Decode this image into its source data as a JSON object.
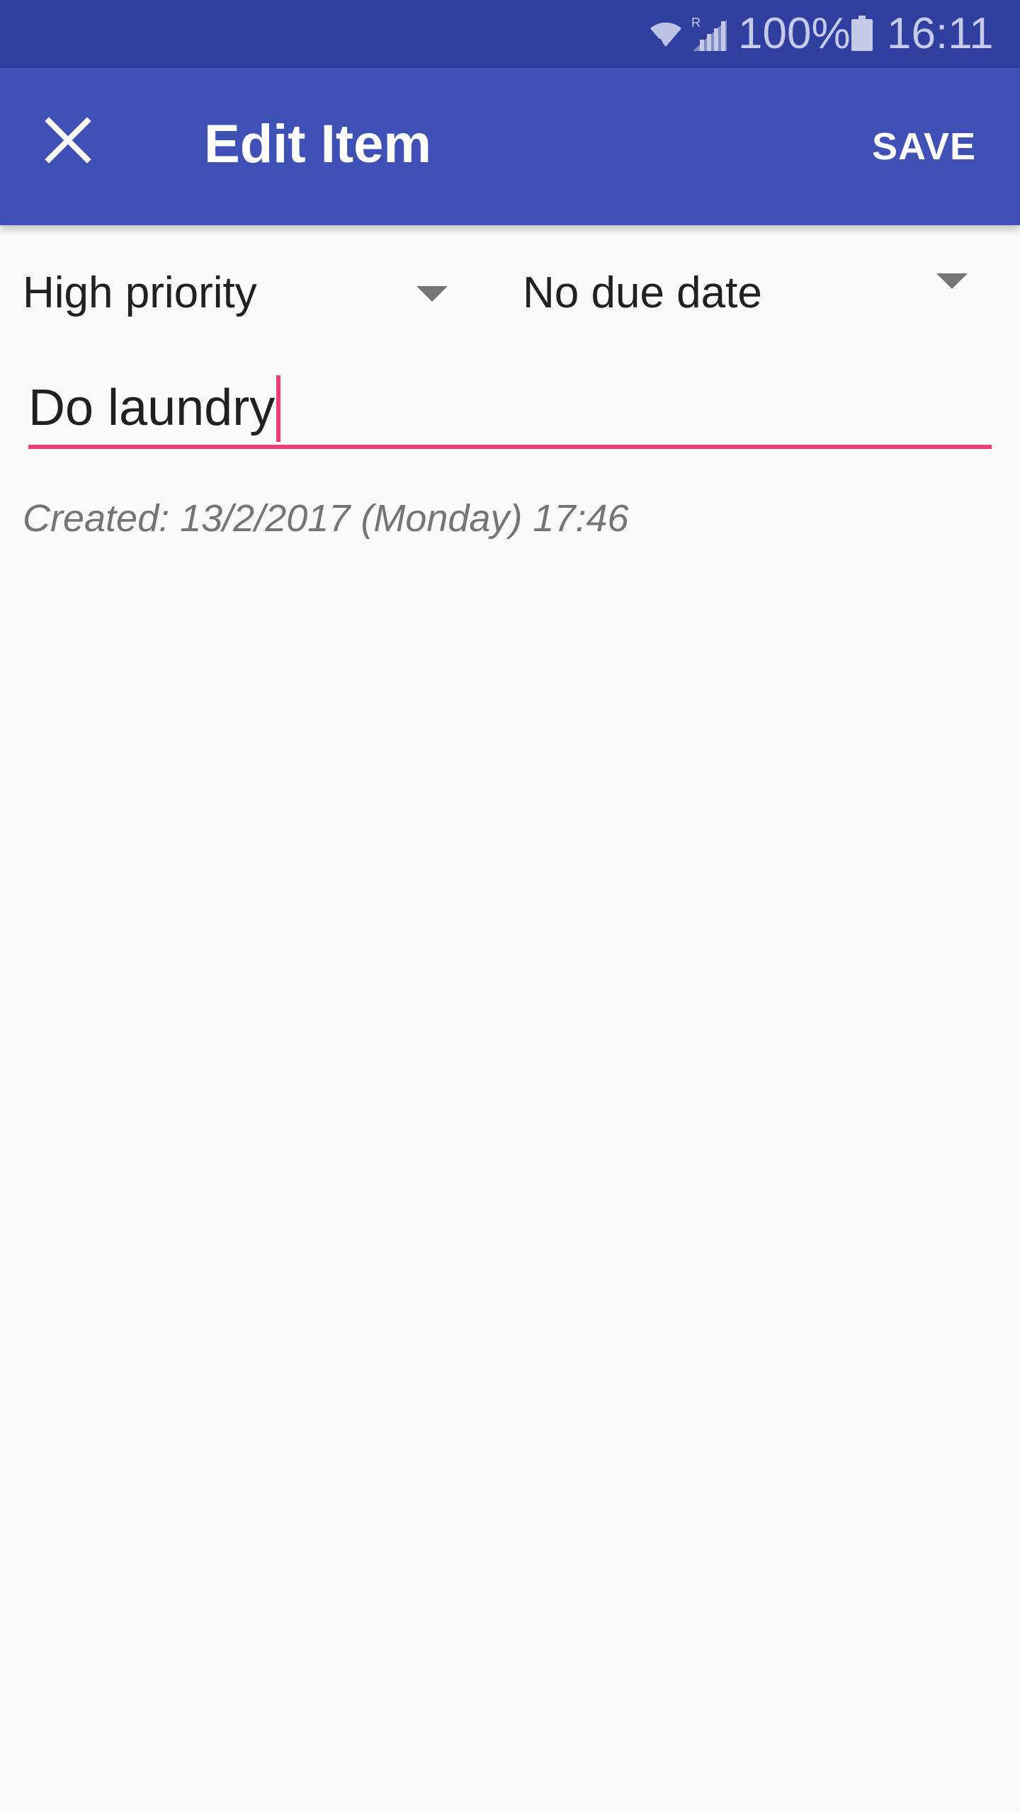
{
  "status_bar": {
    "battery_percent": "100%",
    "time": "16:11",
    "wifi_icon": "wifi-icon",
    "signal_icon": "signal-roaming-icon",
    "battery_icon": "battery-full-icon"
  },
  "app_bar": {
    "title": "Edit Item",
    "save_label": "SAVE",
    "close_icon": "close-icon",
    "color": "#3f51b5",
    "status_color": "#303f9f"
  },
  "form": {
    "priority": "High priority",
    "due_date": "No due date",
    "item_text": "Do laundry",
    "created": "Created: 13/2/2017 (Monday) 17:46",
    "accent_color": "#ec407a"
  }
}
